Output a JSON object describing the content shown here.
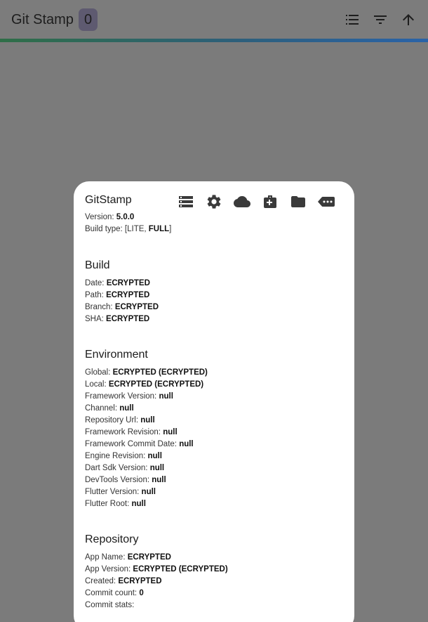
{
  "appbar": {
    "title": "Git Stamp",
    "count": "0",
    "icons": [
      "list-icon",
      "filter-icon",
      "arrow-up-icon"
    ]
  },
  "card": {
    "title": "GitStamp",
    "icons": [
      "storage-icon",
      "settings-icon",
      "cloud-icon",
      "medical-bag-icon",
      "folder-icon",
      "more-tag-icon"
    ],
    "info": {
      "version_label": "Version: ",
      "version_value": "5.0.0",
      "build_type_label": "Build type: ",
      "build_type_open": "[LITE, ",
      "build_type_full": "FULL",
      "build_type_close": "]"
    },
    "sections": {
      "build": {
        "title": "Build",
        "rows": [
          {
            "label": "Date: ",
            "value": "ECRYPTED"
          },
          {
            "label": "Path: ",
            "value": "ECRYPTED"
          },
          {
            "label": "Branch: ",
            "value": "ECRYPTED"
          },
          {
            "label": "SHA: ",
            "value": "ECRYPTED"
          }
        ]
      },
      "environment": {
        "title": "Environment",
        "rows": [
          {
            "label": "Global: ",
            "value": "ECRYPTED (ECRYPTED)"
          },
          {
            "label": "Local: ",
            "value": "ECRYPTED (ECRYPTED)"
          },
          {
            "label": "Framework Version: ",
            "value": "null"
          },
          {
            "label": "Channel: ",
            "value": "null"
          },
          {
            "label": "Repository Url: ",
            "value": "null"
          },
          {
            "label": "Framework Revision: ",
            "value": "null"
          },
          {
            "label": "Framework Commit Date: ",
            "value": "null"
          },
          {
            "label": "Engine Revision: ",
            "value": "null"
          },
          {
            "label": "Dart Sdk Version: ",
            "value": "null"
          },
          {
            "label": "DevTools Version: ",
            "value": "null"
          },
          {
            "label": "Flutter Version: ",
            "value": "null"
          },
          {
            "label": "Flutter Root: ",
            "value": "null"
          }
        ]
      },
      "repository": {
        "title": "Repository",
        "rows": [
          {
            "label": "App Name: ",
            "value": "ECRYPTED"
          },
          {
            "label": "App Version: ",
            "value": "ECRYPTED (ECRYPTED)"
          },
          {
            "label": "Created: ",
            "value": "ECRYPTED"
          },
          {
            "label": "Commit count: ",
            "value": "0"
          },
          {
            "label": "Commit stats: ",
            "value": ""
          }
        ]
      }
    }
  }
}
